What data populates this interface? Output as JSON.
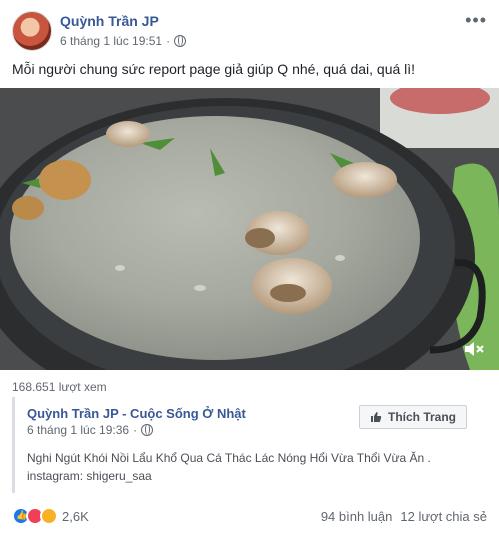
{
  "post": {
    "author": "Quỳnh Trần JP",
    "timestamp": "6 tháng 1 lúc 19:51",
    "separator": "·",
    "privacy_icon": "globe-icon",
    "more_icon": "more-options-icon",
    "caption": "Mỗi người chung sức report page giả giúp Q nhé, quá dai, quá lì!"
  },
  "video": {
    "mute_icon": "speaker-muted-icon",
    "views": "168.651 lượt xem"
  },
  "shared": {
    "author": "Quỳnh Trần JP - Cuộc Sống Ở Nhật",
    "timestamp": "6 tháng 1 lúc 19:36",
    "separator": "·",
    "like_page_label": "Thích Trang",
    "text": "Nghi Ngút Khói Nồi Lẩu Khổ Qua Cá Thác Lác Nóng Hổi Vừa Thổi Vừa Ăn . instagram: shigeru_saa"
  },
  "footer": {
    "reaction_count": "2,6K",
    "comments": "94 bình luận",
    "shares": "12 lượt chia sẻ"
  },
  "colors": {
    "link": "#385898",
    "like": "#1877f2",
    "love": "#f33e58",
    "haha": "#f7b125"
  }
}
